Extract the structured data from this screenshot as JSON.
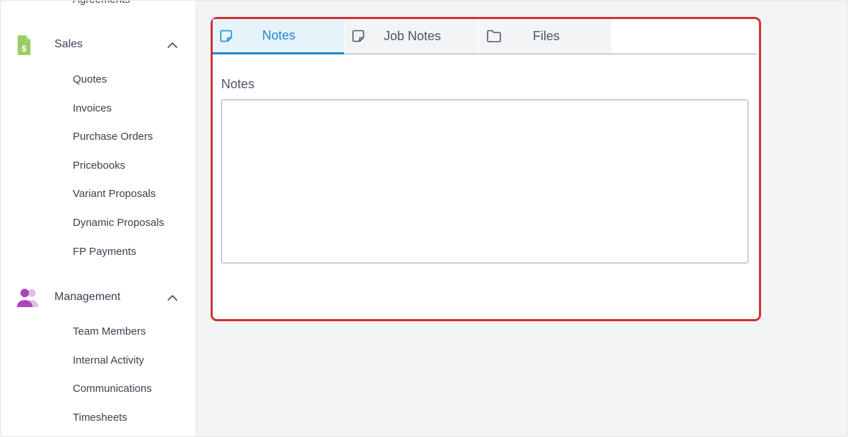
{
  "sidebar": {
    "cut_off_item": "Agreements",
    "sales": {
      "label": "Sales",
      "icon": "invoice-dollar-icon",
      "icon_color": "#8bc34a",
      "items": [
        {
          "label": "Quotes"
        },
        {
          "label": "Invoices"
        },
        {
          "label": "Purchase Orders"
        },
        {
          "label": "Pricebooks"
        },
        {
          "label": "Variant Proposals"
        },
        {
          "label": "Dynamic Proposals"
        },
        {
          "label": "FP Payments"
        }
      ]
    },
    "management": {
      "label": "Management",
      "icon": "users-icon",
      "icon_color": "#b24bb4",
      "items": [
        {
          "label": "Team Members"
        },
        {
          "label": "Internal Activity"
        },
        {
          "label": "Communications"
        },
        {
          "label": "Timesheets"
        }
      ]
    }
  },
  "panel": {
    "highlight_color": "#d32f2f",
    "tabs": [
      {
        "label": "Notes",
        "icon": "sticky-note-icon",
        "active": true
      },
      {
        "label": "Job Notes",
        "icon": "sticky-note-icon",
        "active": false
      },
      {
        "label": "Files",
        "icon": "folder-icon",
        "active": false
      }
    ],
    "notes_label": "Notes",
    "notes_value": ""
  },
  "accent_color": "#1e88c8"
}
